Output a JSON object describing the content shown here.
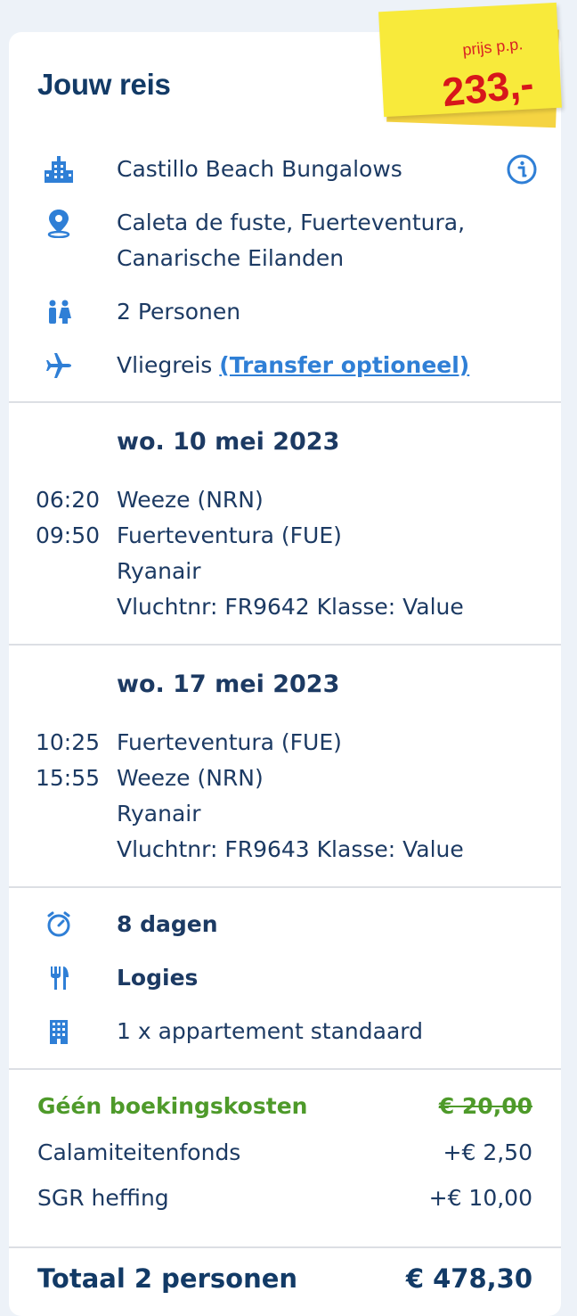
{
  "header": {
    "title": "Jouw reis"
  },
  "price_note": {
    "label": "prijs p.p.",
    "price": "233,-"
  },
  "details": {
    "hotel": "Castillo Beach Bungalows",
    "location_line1": "Caleta de fuste, Fuerteventura,",
    "location_line2": "Canarische Eilanden",
    "persons": "2 Personen",
    "travel_type": "Vliegreis",
    "transfer_link": "(Transfer optioneel)"
  },
  "flights": [
    {
      "date": "wo. 10 mei 2023",
      "dep_time": "06:20",
      "dep_airport": "Weeze (NRN)",
      "arr_time": "09:50",
      "arr_airport": "Fuerteventura (FUE)",
      "airline": "Ryanair",
      "flight_info": "Vluchtnr: FR9642 Klasse: Value"
    },
    {
      "date": "wo. 17 mei 2023",
      "dep_time": "10:25",
      "dep_airport": "Fuerteventura (FUE)",
      "arr_time": "15:55",
      "arr_airport": "Weeze (NRN)",
      "airline": "Ryanair",
      "flight_info": "Vluchtnr: FR9643 Klasse: Value"
    }
  ],
  "stay": {
    "duration": "8 dagen",
    "board": "Logies",
    "room": "1 x appartement standaard"
  },
  "costs": {
    "booking_label": "Géén boekingskosten",
    "booking_value": "€ 20,00",
    "calamity_label": "Calamiteitenfonds",
    "calamity_value": "+€ 2,50",
    "sgr_label": "SGR heffing",
    "sgr_value": "+€ 10,00"
  },
  "total": {
    "label": "Totaal 2 personen",
    "value": "€ 478,30"
  },
  "colors": {
    "navy": "#1c3a63",
    "icon_blue": "#2f7fd6",
    "green": "#4e9a2a",
    "note_yellow": "#f8ea3b",
    "price_red": "#d7161b"
  },
  "icons": [
    "hotel-icon",
    "location-pin-icon",
    "persons-icon",
    "plane-icon",
    "info-icon",
    "timer-icon",
    "cutlery-icon",
    "building-icon"
  ]
}
